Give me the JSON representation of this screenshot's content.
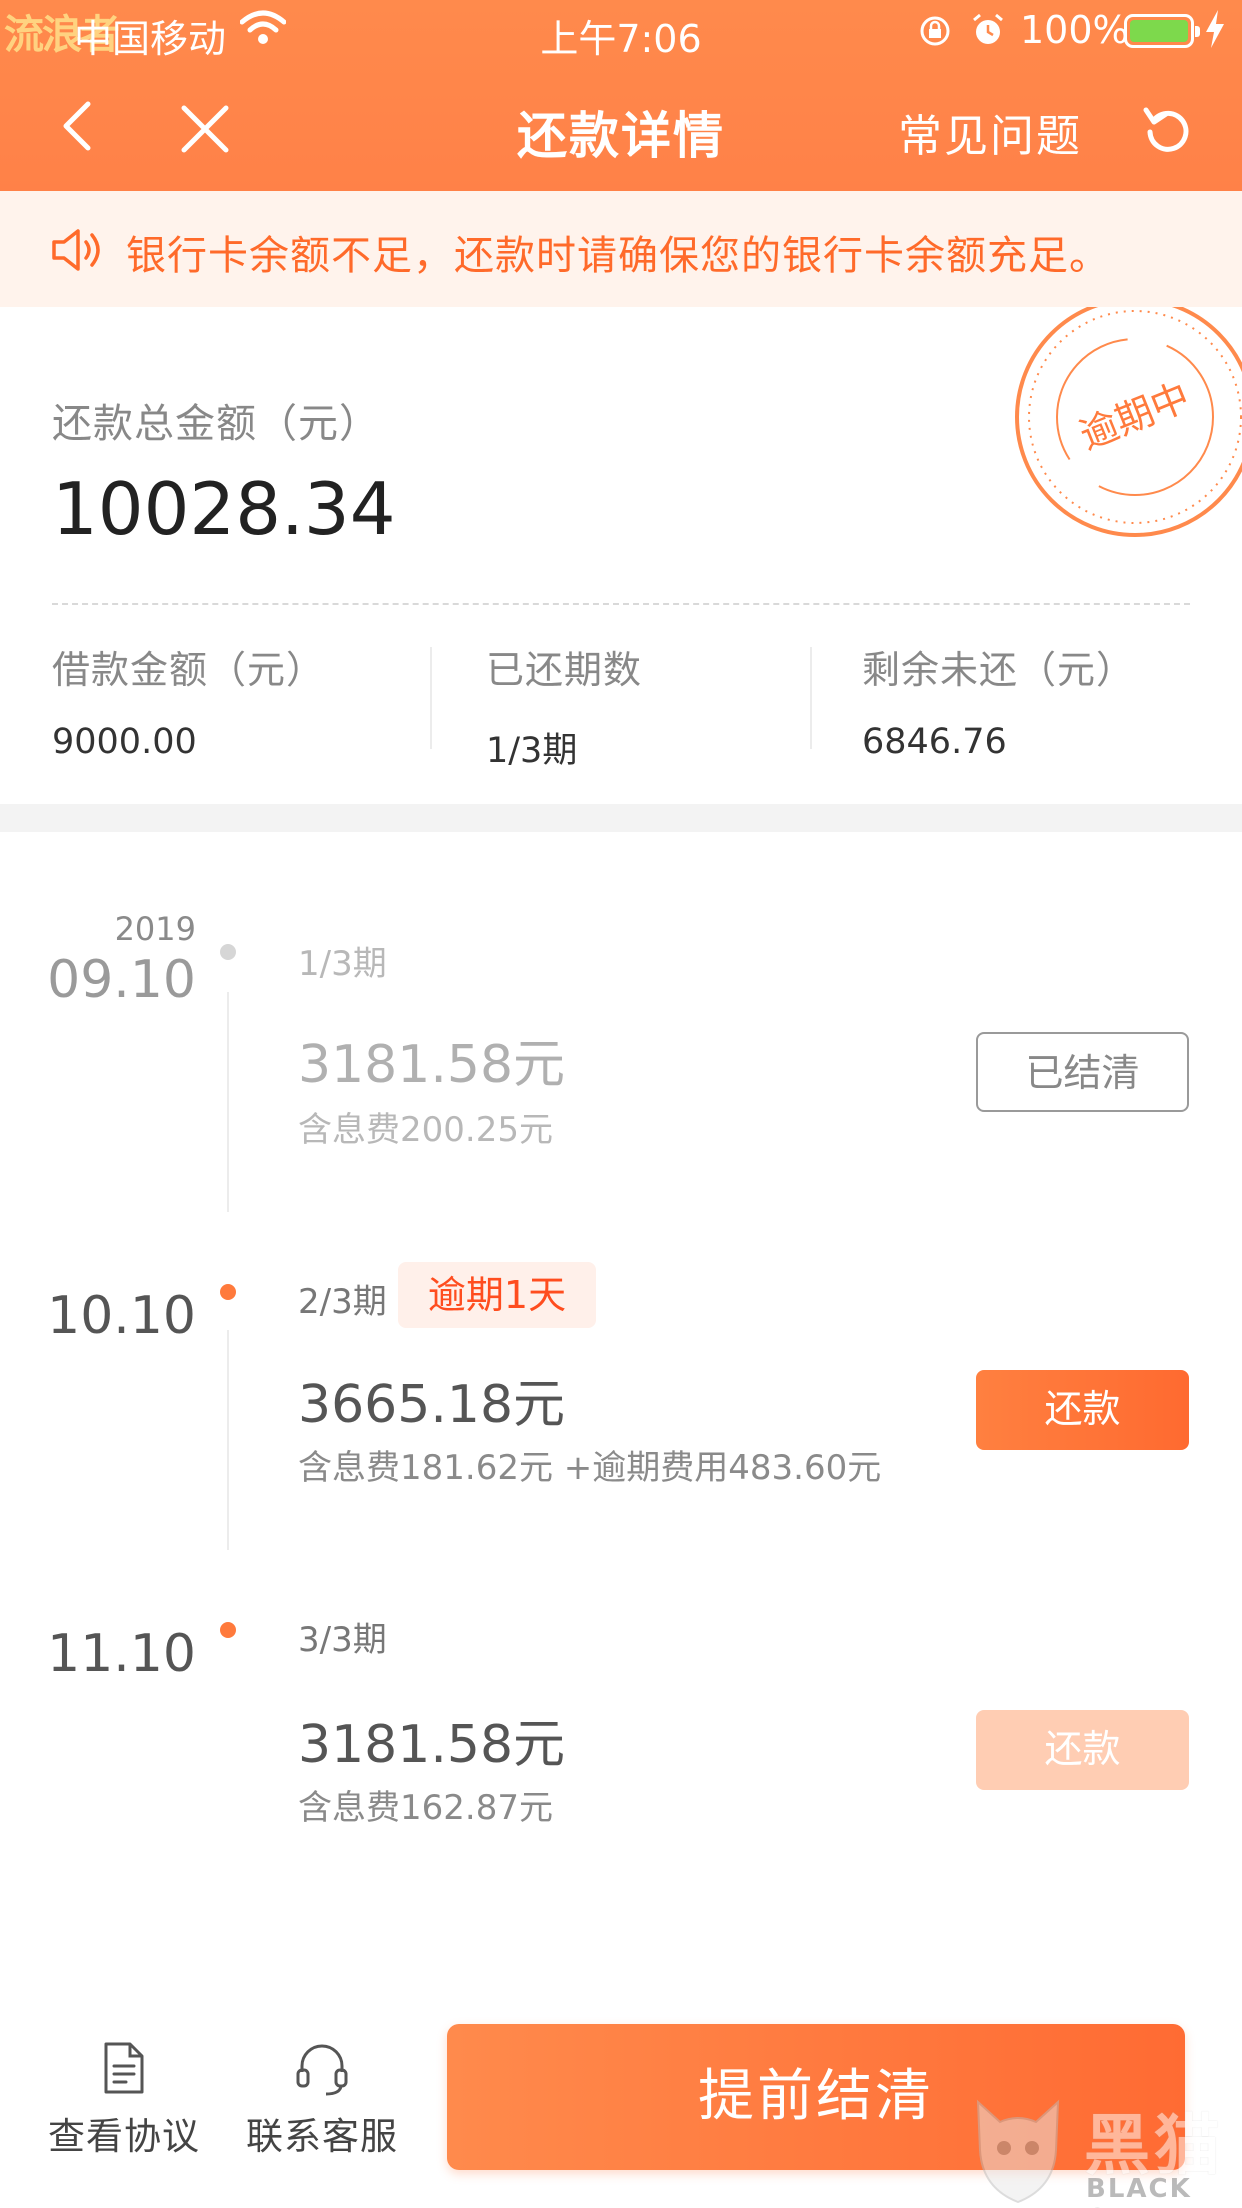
{
  "status_bar": {
    "watermark": "流浪者",
    "carrier": "中国移动",
    "time": "上午7:06",
    "battery": "100%",
    "battery_color": "#7dd94c"
  },
  "nav": {
    "title": "还款详情",
    "faq": "常见问题",
    "bar_color": "#ff8a4c"
  },
  "notice": {
    "text": "银行卡余额不足，还款时请确保您的银行卡余额充足。",
    "color": "#ff6a2a"
  },
  "summary": {
    "total_label": "还款总金额（元）",
    "total_amount": "10028.34",
    "stamp": "逾期中",
    "loan_label": "借款金额（元）",
    "loan_value": "9000.00",
    "paid_label": "已还期数",
    "paid_value": "1/3期",
    "remaining_label": "剩余未还（元）",
    "remaining_value": "6846.76"
  },
  "installments": [
    {
      "year": "2019",
      "date": "09.10",
      "period": "1/3期",
      "amount": "3181.58元",
      "fee": "含息费200.25元",
      "button": "已结清"
    },
    {
      "date": "10.10",
      "period": "2/3期",
      "overdue_tag": "逾期1天",
      "amount": "3665.18元",
      "fee": "含息费181.62元 +逾期费用483.60元",
      "button": "还款"
    },
    {
      "date": "11.10",
      "period": "3/3期",
      "amount": "3181.58元",
      "fee": "含息费162.87元",
      "button": "还款"
    }
  ],
  "bottom": {
    "agreement": "查看协议",
    "service": "联系客服",
    "settle": "提前结清"
  },
  "logo": {
    "cn": "黑猫",
    "en": "BLACK CAT"
  }
}
